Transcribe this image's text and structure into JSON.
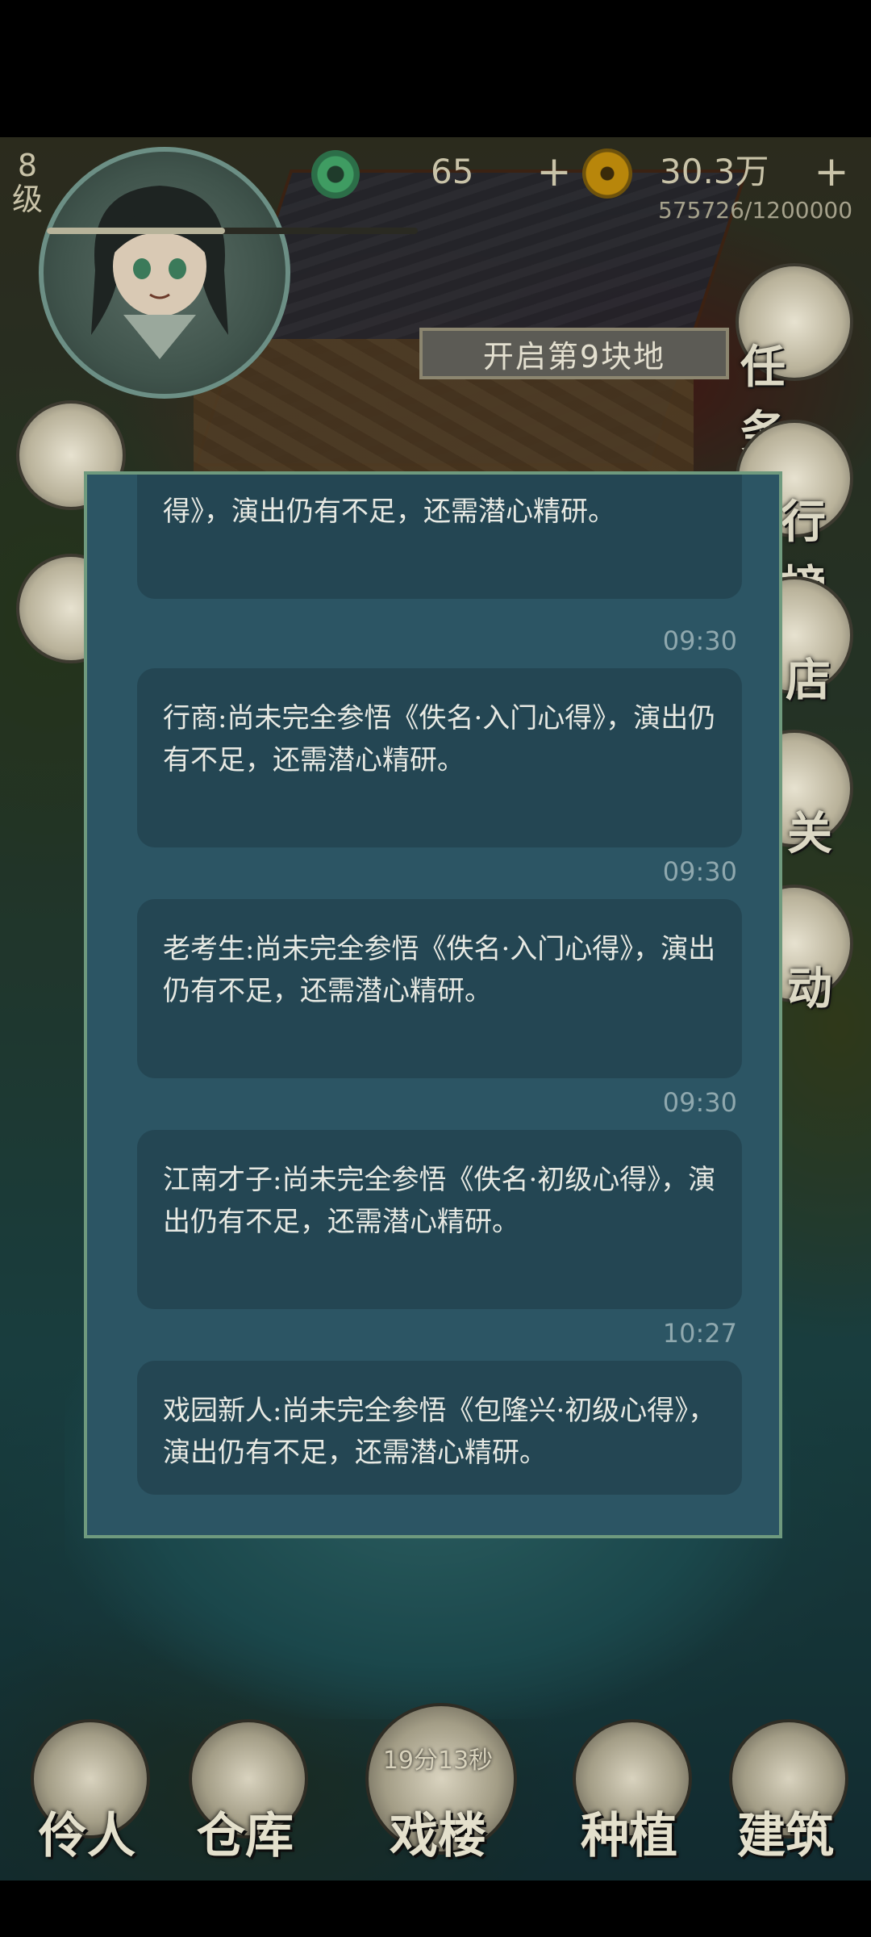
{
  "header": {
    "level_number": "8",
    "level_unit": "级",
    "exp_progress": 0.48,
    "jade_amount": "65",
    "copper_amount": "30.3万",
    "plus_symbol": "+",
    "coin_progress_text": "575726/1200000"
  },
  "banner": {
    "text": "开启第9块地"
  },
  "side_menu": {
    "items": [
      {
        "label": "任务",
        "icon": "scroll-icon"
      },
      {
        "label": "行榜",
        "icon": "ranking-icon"
      },
      {
        "label": "店",
        "icon": "shop-icon"
      },
      {
        "label": "关",
        "icon": "level-icon"
      },
      {
        "label": "动",
        "icon": "event-icon"
      }
    ]
  },
  "messages": [
    {
      "time": "",
      "text": "得》，演出仍有不足，还需潜心精研。"
    },
    {
      "time": "09:30",
      "text": "行商:尚未完全参悟《佚名·入门心得》，演出仍有不足，还需潜心精研。"
    },
    {
      "time": "09:30",
      "text": "老考生:尚未完全参悟《佚名·入门心得》，演出仍有不足，还需潜心精研。"
    },
    {
      "time": "09:30",
      "text": "江南才子:尚未完全参悟《佚名·初级心得》，演出仍有不足，还需潜心精研。"
    },
    {
      "time": "10:27",
      "text": "戏园新人:尚未完全参悟《包隆兴·初级心得》，演出仍有不足，还需潜心精研。"
    }
  ],
  "bottom_nav": {
    "items": [
      {
        "label": "伶人",
        "icon": "performer-icon"
      },
      {
        "label": "仓库",
        "icon": "warehouse-icon"
      },
      {
        "label": "戏楼",
        "icon": "theater-icon",
        "timer": "19分13秒"
      },
      {
        "label": "种植",
        "icon": "plant-icon"
      },
      {
        "label": "建筑",
        "icon": "build-icon"
      }
    ]
  }
}
